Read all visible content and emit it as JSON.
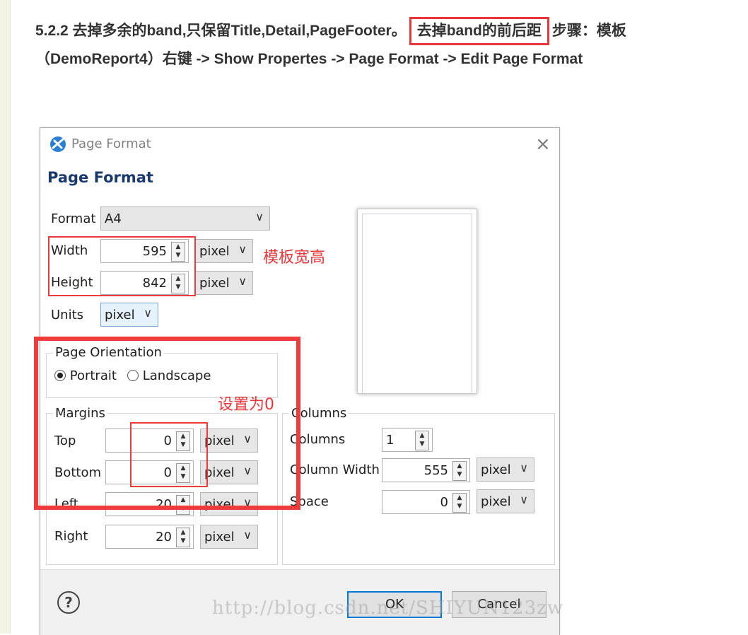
{
  "article": {
    "part1": "5.2.2 去掉多余的band,只保留Title,Detail,PageFooter。",
    "highlight": "去掉band的前后距",
    "part2": "步骤：模板（DemoReport4）右键 -> Show Propertes -> Page Format -> Edit Page Format"
  },
  "dialog": {
    "window_title": "Page Format",
    "heading": "Page Format",
    "close_icon": "close-icon",
    "format": {
      "label": "Format",
      "value": "A4"
    },
    "width": {
      "label": "Width",
      "value": "595",
      "unit": "pixel"
    },
    "height": {
      "label": "Height",
      "value": "842",
      "unit": "pixel"
    },
    "units": {
      "label": "Units",
      "value": "pixel"
    },
    "orientation": {
      "legend": "Page Orientation",
      "portrait": "Portrait",
      "landscape": "Landscape",
      "selected": "Portrait"
    },
    "margins": {
      "legend": "Margins",
      "top": {
        "label": "Top",
        "value": "0",
        "unit": "pixel"
      },
      "bottom": {
        "label": "Bottom",
        "value": "0",
        "unit": "pixel"
      },
      "left": {
        "label": "Left",
        "value": "20",
        "unit": "pixel"
      },
      "right": {
        "label": "Right",
        "value": "20",
        "unit": "pixel"
      }
    },
    "columns": {
      "legend": "Columns",
      "columns": {
        "label": "Columns",
        "value": "1"
      },
      "column_width": {
        "label": "Column Width",
        "value": "555",
        "unit": "pixel"
      },
      "space": {
        "label": "Space",
        "value": "0",
        "unit": "pixel"
      }
    },
    "help_label": "?",
    "ok_label": "OK",
    "cancel_label": "Cancel"
  },
  "annotations": {
    "size_note": "模板宽高",
    "margin_note": "设置为0",
    "color": "#e8373a"
  },
  "watermark": "http://blog.csdn.net/SHIYUN123zw"
}
